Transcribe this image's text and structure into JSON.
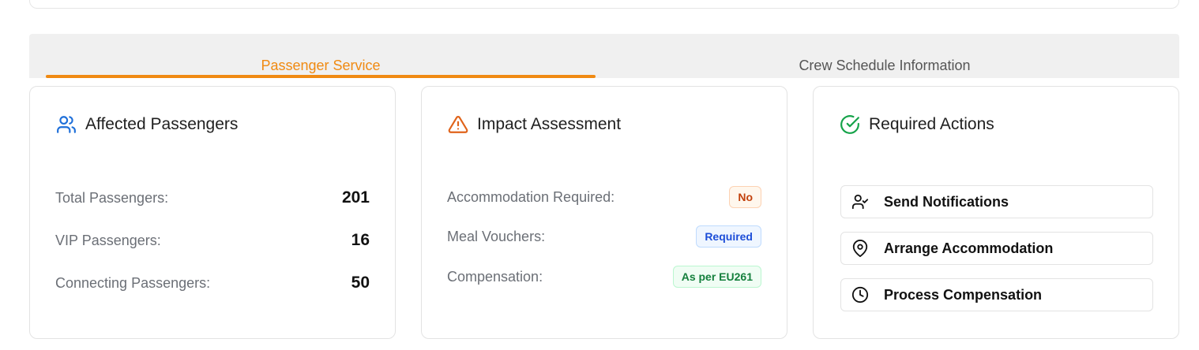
{
  "tabs": [
    {
      "label": "Passenger Service",
      "active": true
    },
    {
      "label": "Crew Schedule Information",
      "active": false
    }
  ],
  "accent_color": "#f08a12",
  "affected_passengers": {
    "title": "Affected Passengers",
    "icon": "users-icon",
    "rows": [
      {
        "label": "Total Passengers:",
        "value": "201"
      },
      {
        "label": "VIP Passengers:",
        "value": "16"
      },
      {
        "label": "Connecting Passengers:",
        "value": "50"
      }
    ]
  },
  "impact_assessment": {
    "title": "Impact Assessment",
    "icon": "warning-triangle-icon",
    "rows": [
      {
        "label": "Accommodation Required:",
        "badge": "No",
        "badge_color": "#c2410c"
      },
      {
        "label": "Meal Vouchers:",
        "badge": "Required",
        "badge_color": "#1d4ed8"
      },
      {
        "label": "Compensation:",
        "badge": "As per EU261",
        "badge_color": "#15803d"
      }
    ]
  },
  "required_actions": {
    "title": "Required Actions",
    "icon": "check-circle-icon",
    "actions": [
      {
        "label": "Send Notifications",
        "icon": "user-check-icon"
      },
      {
        "label": "Arrange Accommodation",
        "icon": "map-pin-icon"
      },
      {
        "label": "Process Compensation",
        "icon": "clock-icon"
      }
    ]
  }
}
